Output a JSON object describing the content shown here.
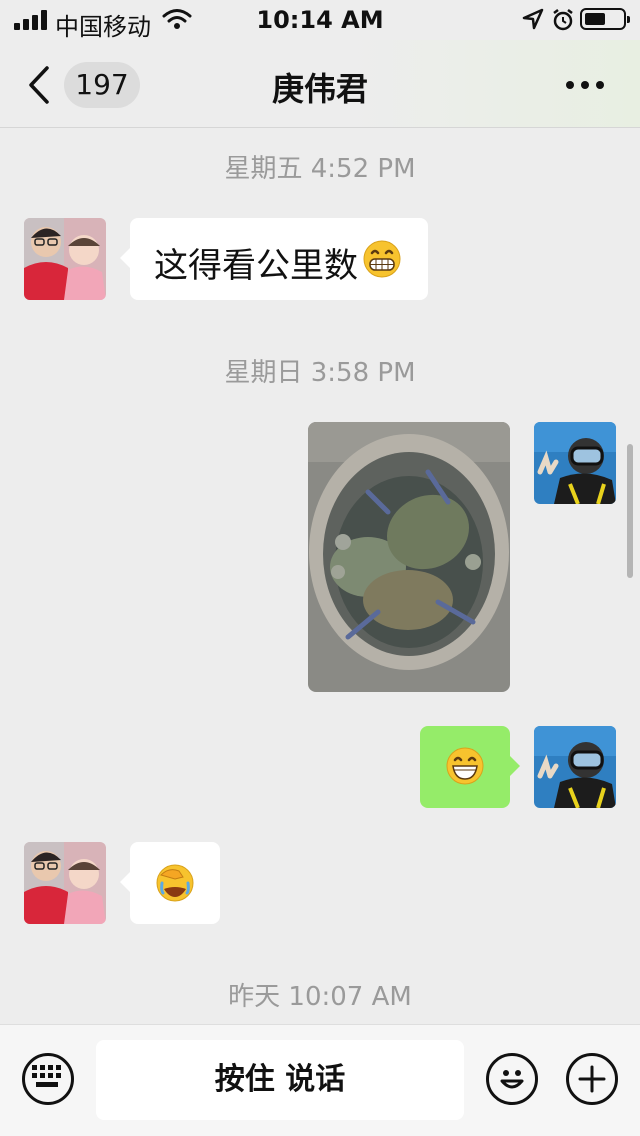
{
  "status_bar": {
    "carrier": "中国移动",
    "time": "10:14 AM",
    "battery_level": 0.55
  },
  "nav": {
    "unread_count": "197",
    "title": "庚伟君"
  },
  "messages": [
    {
      "kind": "timestamp",
      "text": "星期五 4:52 PM"
    },
    {
      "kind": "text",
      "side": "left",
      "text": "这得看公里数",
      "emoji": "grinning-face-emoji"
    },
    {
      "kind": "timestamp",
      "text": "星期日 3:58 PM"
    },
    {
      "kind": "image",
      "side": "right",
      "content": "crabs-in-bowl-photo"
    },
    {
      "kind": "emoji",
      "side": "right",
      "emoji": "big-grin-emoji"
    },
    {
      "kind": "emoji",
      "side": "left",
      "emoji": "facepalm-emoji"
    },
    {
      "kind": "timestamp",
      "text": "昨天 10:07 AM"
    }
  ],
  "input_bar": {
    "voice_label": "按住 说话",
    "icons": [
      "keyboard-icon",
      "smiley-icon",
      "plus-icon"
    ]
  },
  "colors": {
    "background": "#ededed",
    "bubble_self": "#95ec69",
    "bubble_other": "#ffffff",
    "timestamp": "#9a9a9a"
  }
}
